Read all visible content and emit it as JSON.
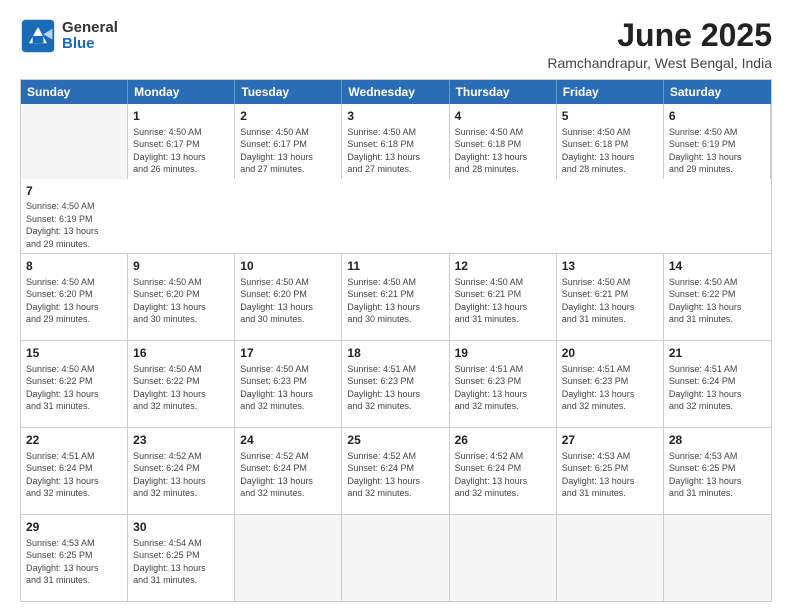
{
  "logo": {
    "general": "General",
    "blue": "Blue"
  },
  "title": "June 2025",
  "subtitle": "Ramchandrapur, West Bengal, India",
  "headers": [
    "Sunday",
    "Monday",
    "Tuesday",
    "Wednesday",
    "Thursday",
    "Friday",
    "Saturday"
  ],
  "rows": [
    [
      {
        "day": "",
        "empty": true
      },
      {
        "day": "1",
        "line1": "Sunrise: 4:50 AM",
        "line2": "Sunset: 6:17 PM",
        "line3": "Daylight: 13 hours",
        "line4": "and 26 minutes."
      },
      {
        "day": "2",
        "line1": "Sunrise: 4:50 AM",
        "line2": "Sunset: 6:17 PM",
        "line3": "Daylight: 13 hours",
        "line4": "and 27 minutes."
      },
      {
        "day": "3",
        "line1": "Sunrise: 4:50 AM",
        "line2": "Sunset: 6:18 PM",
        "line3": "Daylight: 13 hours",
        "line4": "and 27 minutes."
      },
      {
        "day": "4",
        "line1": "Sunrise: 4:50 AM",
        "line2": "Sunset: 6:18 PM",
        "line3": "Daylight: 13 hours",
        "line4": "and 28 minutes."
      },
      {
        "day": "5",
        "line1": "Sunrise: 4:50 AM",
        "line2": "Sunset: 6:18 PM",
        "line3": "Daylight: 13 hours",
        "line4": "and 28 minutes."
      },
      {
        "day": "6",
        "line1": "Sunrise: 4:50 AM",
        "line2": "Sunset: 6:19 PM",
        "line3": "Daylight: 13 hours",
        "line4": "and 29 minutes."
      },
      {
        "day": "7",
        "line1": "Sunrise: 4:50 AM",
        "line2": "Sunset: 6:19 PM",
        "line3": "Daylight: 13 hours",
        "line4": "and 29 minutes."
      }
    ],
    [
      {
        "day": "8",
        "line1": "Sunrise: 4:50 AM",
        "line2": "Sunset: 6:20 PM",
        "line3": "Daylight: 13 hours",
        "line4": "and 29 minutes."
      },
      {
        "day": "9",
        "line1": "Sunrise: 4:50 AM",
        "line2": "Sunset: 6:20 PM",
        "line3": "Daylight: 13 hours",
        "line4": "and 30 minutes."
      },
      {
        "day": "10",
        "line1": "Sunrise: 4:50 AM",
        "line2": "Sunset: 6:20 PM",
        "line3": "Daylight: 13 hours",
        "line4": "and 30 minutes."
      },
      {
        "day": "11",
        "line1": "Sunrise: 4:50 AM",
        "line2": "Sunset: 6:21 PM",
        "line3": "Daylight: 13 hours",
        "line4": "and 30 minutes."
      },
      {
        "day": "12",
        "line1": "Sunrise: 4:50 AM",
        "line2": "Sunset: 6:21 PM",
        "line3": "Daylight: 13 hours",
        "line4": "and 31 minutes."
      },
      {
        "day": "13",
        "line1": "Sunrise: 4:50 AM",
        "line2": "Sunset: 6:21 PM",
        "line3": "Daylight: 13 hours",
        "line4": "and 31 minutes."
      },
      {
        "day": "14",
        "line1": "Sunrise: 4:50 AM",
        "line2": "Sunset: 6:22 PM",
        "line3": "Daylight: 13 hours",
        "line4": "and 31 minutes."
      }
    ],
    [
      {
        "day": "15",
        "line1": "Sunrise: 4:50 AM",
        "line2": "Sunset: 6:22 PM",
        "line3": "Daylight: 13 hours",
        "line4": "and 31 minutes."
      },
      {
        "day": "16",
        "line1": "Sunrise: 4:50 AM",
        "line2": "Sunset: 6:22 PM",
        "line3": "Daylight: 13 hours",
        "line4": "and 32 minutes."
      },
      {
        "day": "17",
        "line1": "Sunrise: 4:50 AM",
        "line2": "Sunset: 6:23 PM",
        "line3": "Daylight: 13 hours",
        "line4": "and 32 minutes."
      },
      {
        "day": "18",
        "line1": "Sunrise: 4:51 AM",
        "line2": "Sunset: 6:23 PM",
        "line3": "Daylight: 13 hours",
        "line4": "and 32 minutes."
      },
      {
        "day": "19",
        "line1": "Sunrise: 4:51 AM",
        "line2": "Sunset: 6:23 PM",
        "line3": "Daylight: 13 hours",
        "line4": "and 32 minutes."
      },
      {
        "day": "20",
        "line1": "Sunrise: 4:51 AM",
        "line2": "Sunset: 6:23 PM",
        "line3": "Daylight: 13 hours",
        "line4": "and 32 minutes."
      },
      {
        "day": "21",
        "line1": "Sunrise: 4:51 AM",
        "line2": "Sunset: 6:24 PM",
        "line3": "Daylight: 13 hours",
        "line4": "and 32 minutes."
      }
    ],
    [
      {
        "day": "22",
        "line1": "Sunrise: 4:51 AM",
        "line2": "Sunset: 6:24 PM",
        "line3": "Daylight: 13 hours",
        "line4": "and 32 minutes."
      },
      {
        "day": "23",
        "line1": "Sunrise: 4:52 AM",
        "line2": "Sunset: 6:24 PM",
        "line3": "Daylight: 13 hours",
        "line4": "and 32 minutes."
      },
      {
        "day": "24",
        "line1": "Sunrise: 4:52 AM",
        "line2": "Sunset: 6:24 PM",
        "line3": "Daylight: 13 hours",
        "line4": "and 32 minutes."
      },
      {
        "day": "25",
        "line1": "Sunrise: 4:52 AM",
        "line2": "Sunset: 6:24 PM",
        "line3": "Daylight: 13 hours",
        "line4": "and 32 minutes."
      },
      {
        "day": "26",
        "line1": "Sunrise: 4:52 AM",
        "line2": "Sunset: 6:24 PM",
        "line3": "Daylight: 13 hours",
        "line4": "and 32 minutes."
      },
      {
        "day": "27",
        "line1": "Sunrise: 4:53 AM",
        "line2": "Sunset: 6:25 PM",
        "line3": "Daylight: 13 hours",
        "line4": "and 31 minutes."
      },
      {
        "day": "28",
        "line1": "Sunrise: 4:53 AM",
        "line2": "Sunset: 6:25 PM",
        "line3": "Daylight: 13 hours",
        "line4": "and 31 minutes."
      }
    ],
    [
      {
        "day": "29",
        "line1": "Sunrise: 4:53 AM",
        "line2": "Sunset: 6:25 PM",
        "line3": "Daylight: 13 hours",
        "line4": "and 31 minutes."
      },
      {
        "day": "30",
        "line1": "Sunrise: 4:54 AM",
        "line2": "Sunset: 6:25 PM",
        "line3": "Daylight: 13 hours",
        "line4": "and 31 minutes."
      },
      {
        "day": "",
        "empty": true
      },
      {
        "day": "",
        "empty": true
      },
      {
        "day": "",
        "empty": true
      },
      {
        "day": "",
        "empty": true
      },
      {
        "day": "",
        "empty": true
      }
    ]
  ]
}
